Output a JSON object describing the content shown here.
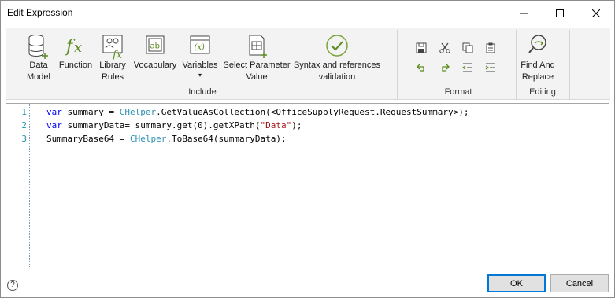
{
  "window": {
    "title": "Edit Expression"
  },
  "ribbon": {
    "include": {
      "label": "Include",
      "items": [
        {
          "line1": "Data",
          "line2": "Model"
        },
        {
          "line1": "Function",
          "line2": ""
        },
        {
          "line1": "Library",
          "line2": "Rules"
        },
        {
          "line1": "Vocabulary",
          "line2": ""
        },
        {
          "line1": "Variables",
          "line2": "▾"
        },
        {
          "line1": "Select Parameter",
          "line2": "Value"
        },
        {
          "line1": "Syntax and references",
          "line2": "validation"
        }
      ]
    },
    "format": {
      "label": "Format",
      "icons": [
        "save-icon",
        "cut-icon",
        "copy-icon",
        "paste-icon",
        "undo-icon",
        "redo-icon",
        "outdent-icon",
        "indent-icon"
      ]
    },
    "editing": {
      "label": "Editing",
      "items": [
        {
          "line1": "Find And",
          "line2": "Replace"
        }
      ]
    }
  },
  "editor": {
    "line_numbers": [
      "1",
      "2",
      "3"
    ],
    "lines": [
      [
        {
          "t": "var",
          "c": "kw"
        },
        {
          "t": " summary = ",
          "c": ""
        },
        {
          "t": "CHelper",
          "c": "cls"
        },
        {
          "t": ".GetValueAsCollection(<OfficeSupplyRequest.RequestSummary>);",
          "c": ""
        }
      ],
      [
        {
          "t": "var",
          "c": "kw"
        },
        {
          "t": " summaryData= summary.get(0).getXPath(",
          "c": ""
        },
        {
          "t": "\"Data\"",
          "c": "str"
        },
        {
          "t": ");",
          "c": ""
        }
      ],
      [
        {
          "t": "SummaryBase64 = ",
          "c": ""
        },
        {
          "t": "CHelper",
          "c": "cls"
        },
        {
          "t": ".ToBase64(summaryData);",
          "c": ""
        }
      ]
    ]
  },
  "footer": {
    "help": "?",
    "ok": "OK",
    "cancel": "Cancel"
  },
  "colors": {
    "keyword": "#0000ff",
    "class": "#2b91af",
    "string": "#a31515",
    "line_number": "#2b91af",
    "icon_green": "#5a8a1e",
    "accent": "#0078d7"
  }
}
